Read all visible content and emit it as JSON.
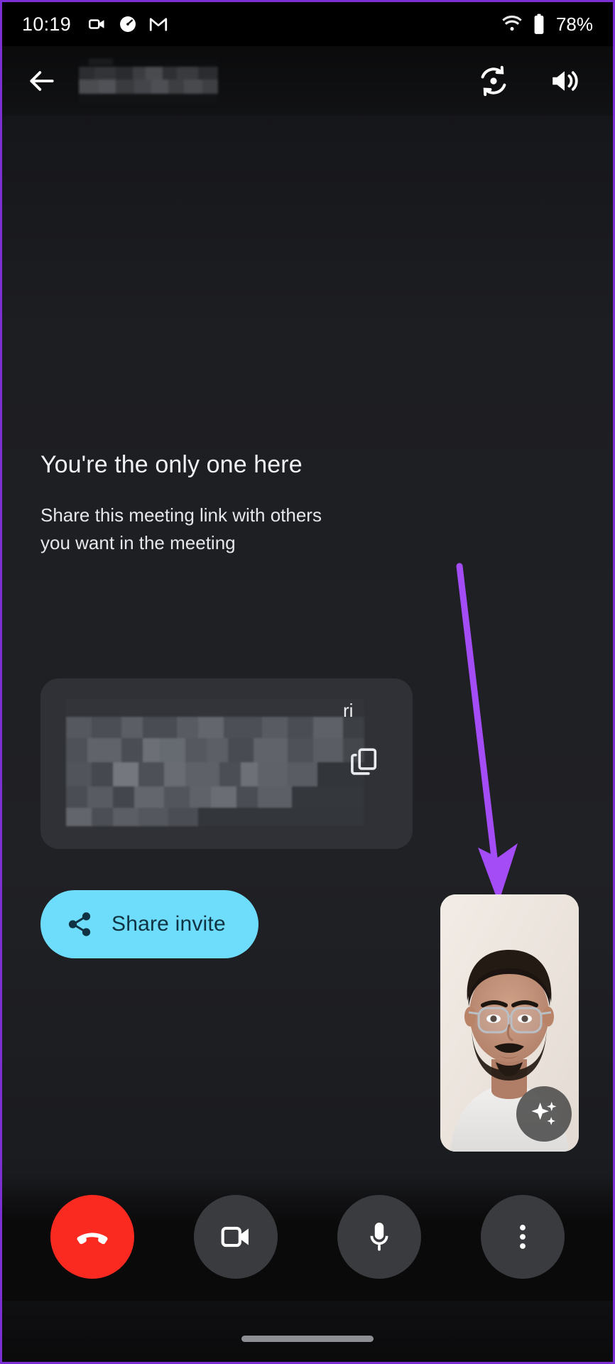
{
  "status_bar": {
    "time": "10:19",
    "battery_percent": "78%",
    "icons": [
      "video-camera-icon",
      "speedometer-icon",
      "gmail-icon",
      "wifi-icon",
      "battery-icon"
    ]
  },
  "app_bar": {
    "back_label": "Back",
    "meeting_title": "",
    "meeting_title_redacted": true,
    "actions": [
      {
        "name": "flip-camera",
        "label": "Switch camera"
      },
      {
        "name": "speaker",
        "label": "Speaker"
      }
    ]
  },
  "empty_state": {
    "title": "You're the only one here",
    "subtitle": "Share this meeting link with others you want in the meeting"
  },
  "meeting_link": {
    "value": "",
    "redacted": true,
    "visible_tail": "ri",
    "copy_label": "Copy meeting link"
  },
  "share_invite": {
    "label": "Share invite",
    "icon": "share-icon",
    "bg_color": "#6EDCFB",
    "text_color": "#103344"
  },
  "self_view": {
    "label": "You",
    "effects_label": "Apply visual effects",
    "effects_icon": "sparkles-icon"
  },
  "annotation": {
    "type": "arrow",
    "color": "#A44CF6",
    "points_to": "self-view-thumbnail"
  },
  "controls": [
    {
      "name": "end-call",
      "label": "Leave call",
      "icon": "phone-hangup-icon",
      "color": "#FA2A20"
    },
    {
      "name": "camera-toggle",
      "label": "Turn off camera",
      "icon": "video-camera-icon",
      "color": "#3A3B3E"
    },
    {
      "name": "mic-toggle",
      "label": "Mute microphone",
      "icon": "microphone-icon",
      "color": "#3A3B3E"
    },
    {
      "name": "more-options",
      "label": "More options",
      "icon": "dots-vertical-icon",
      "color": "#3A3B3E"
    }
  ],
  "nav_bar": {
    "gesture_pill": true
  }
}
